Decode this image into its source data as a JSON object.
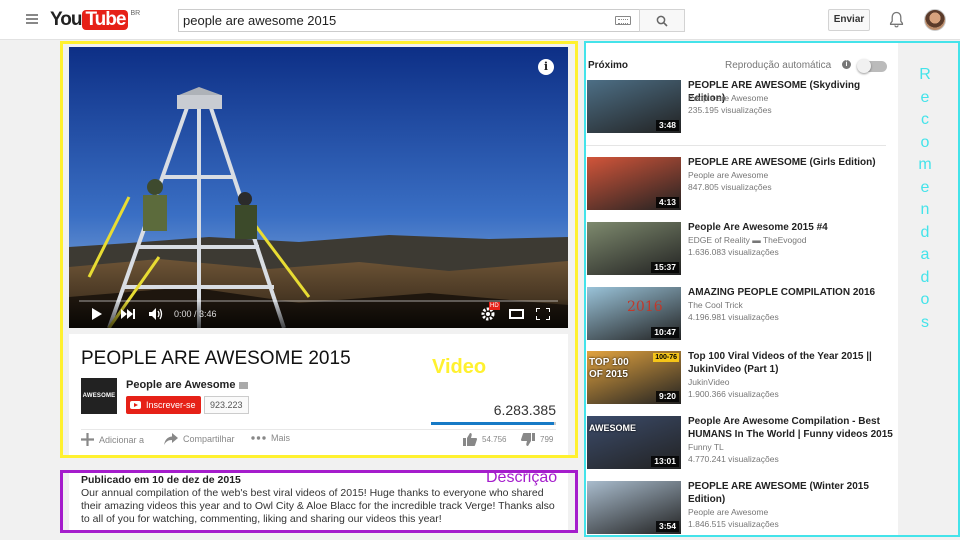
{
  "header": {
    "logo_you": "You",
    "logo_tube": "Tube",
    "region": "BR",
    "search_value": "people are awesome 2015",
    "upload_label": "Enviar"
  },
  "player": {
    "time": "0:00 / 3:46",
    "hd_badge": "HD",
    "progress_fraction": 0.0
  },
  "video": {
    "title": "PEOPLE ARE AWESOME 2015",
    "channel": "People are Awesome",
    "channel_thumb": "AWESOME",
    "subscribe_label": "Inscrever-se",
    "subscribers": "923.223",
    "views": "6.283.385",
    "like_ratio": 0.986,
    "add_label": "Adicionar a",
    "share_label": "Compartilhar",
    "more_label": "Mais",
    "likes": "54.756",
    "dislikes": "799"
  },
  "description": {
    "published": "Publicado em 10 de dez de 2015",
    "text": "Our annual compilation of the web's best viral videos of 2015! Huge thanks to everyone who shared their amazing videos this year and to Owl City & Aloe Blacc for the incredible track Verge! Thanks also to all of you for watching, commenting, liking and sharing our videos this year!"
  },
  "annotations": {
    "video": "Video",
    "description": "Descrição",
    "recommended": [
      "R",
      "e",
      "c",
      "o",
      "m",
      "e",
      "n",
      "d",
      "a",
      "d",
      "o",
      "s"
    ]
  },
  "sidebar": {
    "next_label": "Próximo",
    "autoplay_label": "Reprodução automática",
    "autoplay_on": false,
    "items": [
      {
        "title": "PEOPLE ARE AWESOME (Skydiving Edition)",
        "channel": "People are Awesome",
        "views": "235.195 visualizações",
        "duration": "3:48",
        "thumb_color": "#4d6f86"
      },
      {
        "title": "PEOPLE ARE AWESOME (Girls Edition)",
        "channel": "People are Awesome",
        "views": "847.805 visualizações",
        "duration": "4:13",
        "thumb_color": "#d2553a"
      },
      {
        "title": "People Are Awesome 2015 #4",
        "channel": "EDGE of Reality ▬ TheEvogod",
        "views": "1.636.083 visualizações",
        "duration": "15:37",
        "thumb_color": "#7e8a6e"
      },
      {
        "title": "AMAZING PEOPLE COMPILATION 2016",
        "channel": "The Cool Trick",
        "views": "4.196.981 visualizações",
        "duration": "10:47",
        "thumb_color": "#9ac3d9",
        "overlay": "2016"
      },
      {
        "title": "Top 100 Viral Videos of the Year 2015 || JukinVideo (Part 1)",
        "channel": "JukinVideo",
        "views": "1.900.366 visualizações",
        "duration": "9:20",
        "thumb_color": "#e2a33f",
        "overlay": "TOP 100 OF 2015",
        "overlay2": "100-76"
      },
      {
        "title": "People Are Awesome Compilation - Best HUMANS In The World | Funny videos 2015",
        "channel": "Funny TL",
        "views": "4.770.241 visualizações",
        "duration": "13:01",
        "thumb_color": "#3c4c6b",
        "overlay": "AWESOME"
      },
      {
        "title": "PEOPLE ARE AWESOME (Winter 2015 Edition)",
        "channel": "People are Awesome",
        "views": "1.846.515 visualizações",
        "duration": "3:54",
        "thumb_color": "#a9bccd"
      }
    ]
  },
  "colors": {
    "brand_red": "#e62117",
    "annot_video": "#fff12f",
    "annot_desc": "#a51dcc",
    "annot_reco": "#44e3ea"
  }
}
